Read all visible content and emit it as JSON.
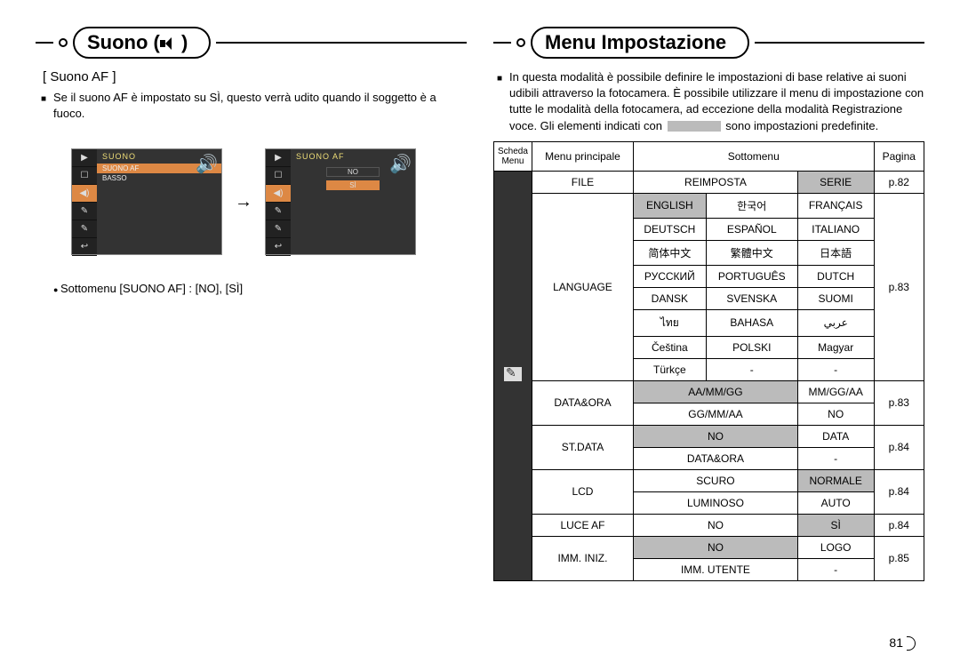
{
  "left": {
    "header": "Suono (",
    "header_suffix": ")",
    "subtitle": "[ Suono AF ]",
    "desc": "Se il suono AF è impostato su SÌ, questo verrà udito quando il soggetto è a fuoco.",
    "screen1": {
      "top": "SUONO",
      "rows": [
        "SUONO AF",
        "BASSO"
      ]
    },
    "screen2": {
      "top": "SUONO AF",
      "opts": [
        "NO",
        "SÌ"
      ]
    },
    "bullet": "Sottomenu [SUONO AF] : [NO], [SÌ]"
  },
  "right": {
    "header": "Menu Impostazione",
    "desc_a": "In questa modalità è possibile definire le impostazioni di base relative ai suoni udibili attraverso la fotocamera. È possibile utilizzare il menu di impostazione con tutte le modalità della fotocamera, ad eccezione della modalità Registrazione voce. Gli elementi indicati con",
    "desc_b": "sono impostazioni predefinite.",
    "table_header": {
      "c1": "Scheda Menu",
      "c2": "Menu principale",
      "c3": "Sottomenu",
      "c4": "Pagina"
    },
    "rows": {
      "file": {
        "main": "FILE",
        "s1": "REIMPOSTA",
        "s2": "SERIE",
        "page": "p.82"
      },
      "lang": {
        "main": "LANGUAGE",
        "grid": [
          [
            "ENGLISH",
            "한국어",
            "FRANÇAIS"
          ],
          [
            "DEUTSCH",
            "ESPAÑOL",
            "ITALIANO"
          ],
          [
            "简体中文",
            "繁體中文",
            "日本語"
          ],
          [
            "РУССКИЙ",
            "PORTUGUÊS",
            "DUTCH"
          ],
          [
            "DANSK",
            "SVENSKA",
            "SUOMI"
          ],
          [
            "ไทย",
            "BAHASA",
            "عربي"
          ],
          [
            "Čeština",
            "POLSKI",
            "Magyar"
          ],
          [
            "Türkçe",
            "-",
            "-"
          ]
        ],
        "page": "p.83"
      },
      "data_ora": {
        "main": "DATA&ORA",
        "r1c1": "AA/MM/GG",
        "r1c2": "MM/GG/AA",
        "r2c1": "GG/MM/AA",
        "r2c2": "NO",
        "page": "p.83"
      },
      "stdata": {
        "main": "ST.DATA",
        "r1c1": "NO",
        "r1c2": "DATA",
        "r2c1": "DATA&ORA",
        "r2c2": "-",
        "page": "p.84"
      },
      "lcd": {
        "main": "LCD",
        "r1c1": "SCURO",
        "r1c2": "NORMALE",
        "r2c1": "LUMINOSO",
        "r2c2": "AUTO",
        "page": "p.84"
      },
      "luceaf": {
        "main": "LUCE AF",
        "c1": "NO",
        "c2": "SÌ",
        "page": "p.84"
      },
      "imminiz": {
        "main": "IMM. INIZ.",
        "r1c1": "NO",
        "r1c2": "LOGO",
        "r2c1": "IMM. UTENTE",
        "r2c2": "-",
        "page": "p.85"
      }
    }
  },
  "page_number": "81"
}
